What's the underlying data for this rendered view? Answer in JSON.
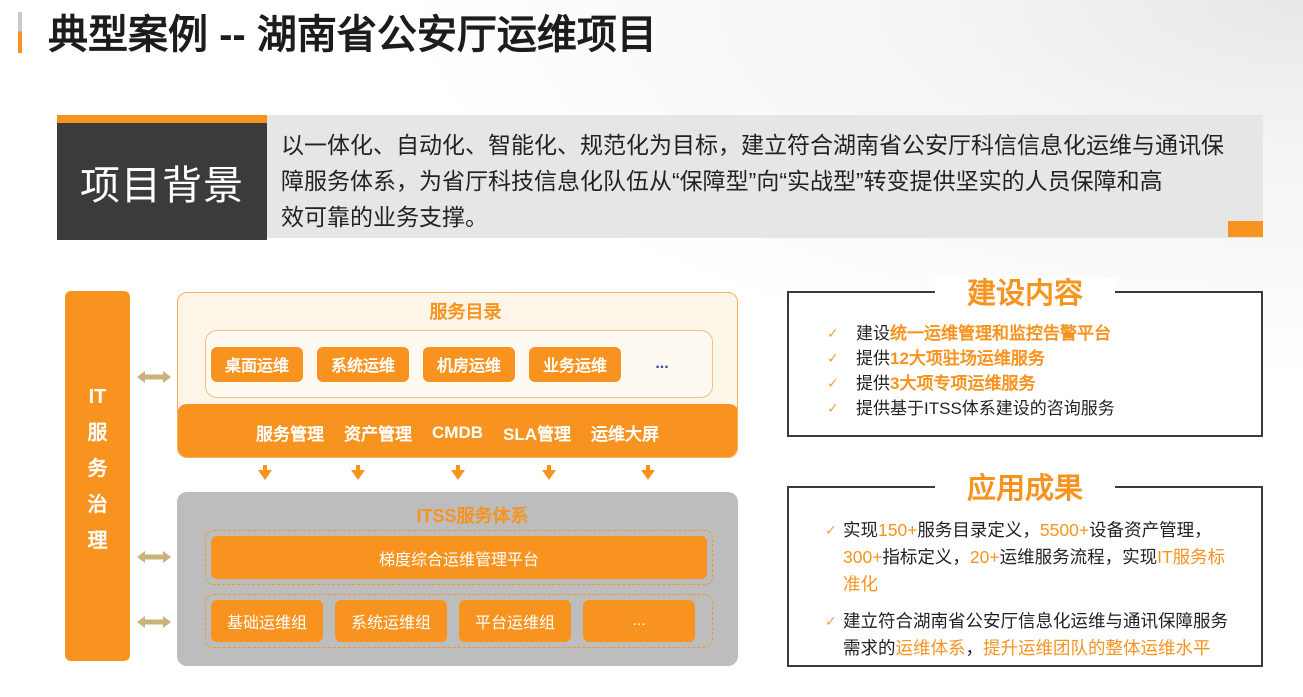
{
  "slide": {
    "title": "典型案例 -- 湖南省公安厅运维项目"
  },
  "colors": {
    "accent": "#f7931e",
    "dark_panel": "#3b3b3b",
    "itss_panel": "#bdbdbd",
    "connector": "#c9b27c",
    "ellipsis_blue": "#2f4f8f"
  },
  "icons": {
    "check": "check-icon",
    "connector": "double-arrow-icon",
    "flow": "down-arrow-icon"
  },
  "project_background": {
    "label": "项目背景",
    "lines": [
      "以一体化、自动化、智能化、规范化为目标，建立符合湖南省公安厅科信信息化运维与通讯保",
      "障服务体系，为省厅科技信息化队伍从“保障型”向“实战型”转变提供坚实的人员保障和高",
      "效可靠的业务支撑。"
    ]
  },
  "it_governance": {
    "label_lines": [
      "IT",
      "服",
      "务",
      "治",
      "理"
    ]
  },
  "service_catalog": {
    "title": "服务目录",
    "items": [
      "桌面运维",
      "系统运维",
      "机房运维",
      "业务运维",
      "..."
    ],
    "functions": [
      "服务管理",
      "资产管理",
      "CMDB",
      "SLA管理",
      "运维大屏"
    ]
  },
  "itss": {
    "title": "ITSS服务体系",
    "platform": "梯度综合运维管理平台",
    "groups": [
      "基础运维组",
      "系统运维组",
      "平台运维组",
      "..."
    ]
  },
  "build_content": {
    "title": "建设内容",
    "items": [
      [
        {
          "text": "建设"
        },
        {
          "text": "统一运维管理和监控告警平台",
          "em": true
        }
      ],
      [
        {
          "text": "提供"
        },
        {
          "text": "12大项驻场运维服务",
          "em": true
        }
      ],
      [
        {
          "text": "提供"
        },
        {
          "text": "3大项专项运维服务",
          "em": true
        }
      ],
      [
        {
          "text": "提供基于ITSS体系建设的咨询服务"
        }
      ]
    ]
  },
  "results": {
    "title": "应用成果",
    "items": [
      [
        [
          {
            "text": "实现"
          },
          {
            "text": "150+",
            "em": true
          },
          {
            "text": "服务目录定义，"
          },
          {
            "text": "5500+",
            "em": true
          },
          {
            "text": "设备资产管理，"
          }
        ],
        [
          {
            "text": "300+",
            "em": true
          },
          {
            "text": "指标定义，"
          },
          {
            "text": "20+",
            "em": true
          },
          {
            "text": "运维服务流程，实现"
          },
          {
            "text": "IT服务标",
            "em": true
          }
        ],
        [
          {
            "text": "准化",
            "em": true
          }
        ]
      ],
      [
        [
          {
            "text": "建立符合湖南省公安厅信息化运维与通讯保障服务"
          }
        ],
        [
          {
            "text": "需求的"
          },
          {
            "text": "运维体系",
            "em": true
          },
          {
            "text": "，"
          },
          {
            "text": "提升运维团队的整体运维水平",
            "em": true
          }
        ]
      ]
    ]
  }
}
